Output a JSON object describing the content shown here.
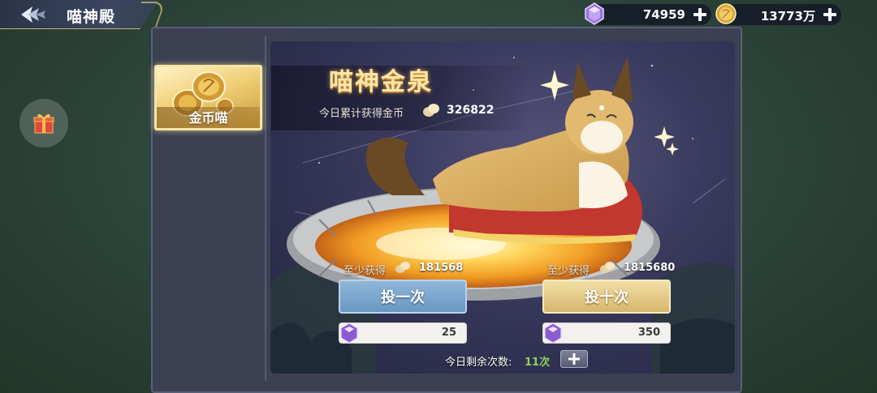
{
  "header": {
    "title": "喵神殿",
    "back_icon": "back-arrow-icon"
  },
  "currencies": [
    {
      "icon": "purple-gem-icon",
      "value": "74959"
    },
    {
      "icon": "gold-coin-icon",
      "value": "13773万"
    }
  ],
  "sidebar": {
    "tabs": [
      {
        "label": "金币喵",
        "selected": true,
        "icon": "gold-coins-icon"
      }
    ]
  },
  "gift_icon": "gift-box-icon",
  "fountain": {
    "title": "喵神金泉",
    "daily_total_label": "今日累计获得金币",
    "daily_total_value": "326822",
    "options": [
      {
        "min_label": "至少获得",
        "min_value": "181568",
        "button_label": "投一次",
        "cost": "25"
      },
      {
        "min_label": "至少获得",
        "min_value": "1815680",
        "button_label": "投十次",
        "cost": "350"
      }
    ],
    "remaining_label": "今日剩余次数:",
    "remaining_value": "11次"
  },
  "colors": {
    "accent_gold": "#ffe6a8",
    "button_blue": "#6a98c4",
    "button_gold": "#d7b66c",
    "remaining_green": "#8fd35a",
    "panel_bg": "#3b4053"
  }
}
